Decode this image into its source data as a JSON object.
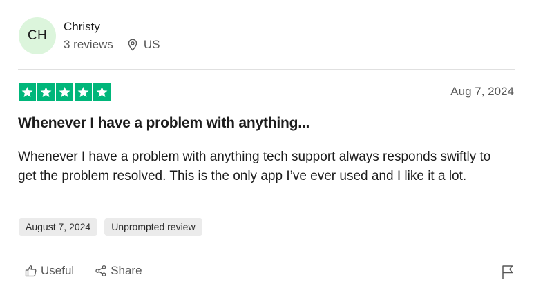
{
  "reviewer": {
    "initials": "CH",
    "name": "Christy",
    "review_count": "3 reviews",
    "country": "US"
  },
  "review": {
    "rating": 5,
    "date": "Aug 7, 2024",
    "title": "Whenever I have a problem with anything...",
    "body": "Whenever I have a problem with anything tech support always responds swiftly to get the problem resolved. This is the only app I’ve ever used and I like it a lot.",
    "tags": [
      "August 7, 2024",
      "Unprompted review"
    ]
  },
  "actions": {
    "useful": "Useful",
    "share": "Share"
  },
  "colors": {
    "star": "#00b67a",
    "avatar_bg": "#dcf5dc"
  }
}
